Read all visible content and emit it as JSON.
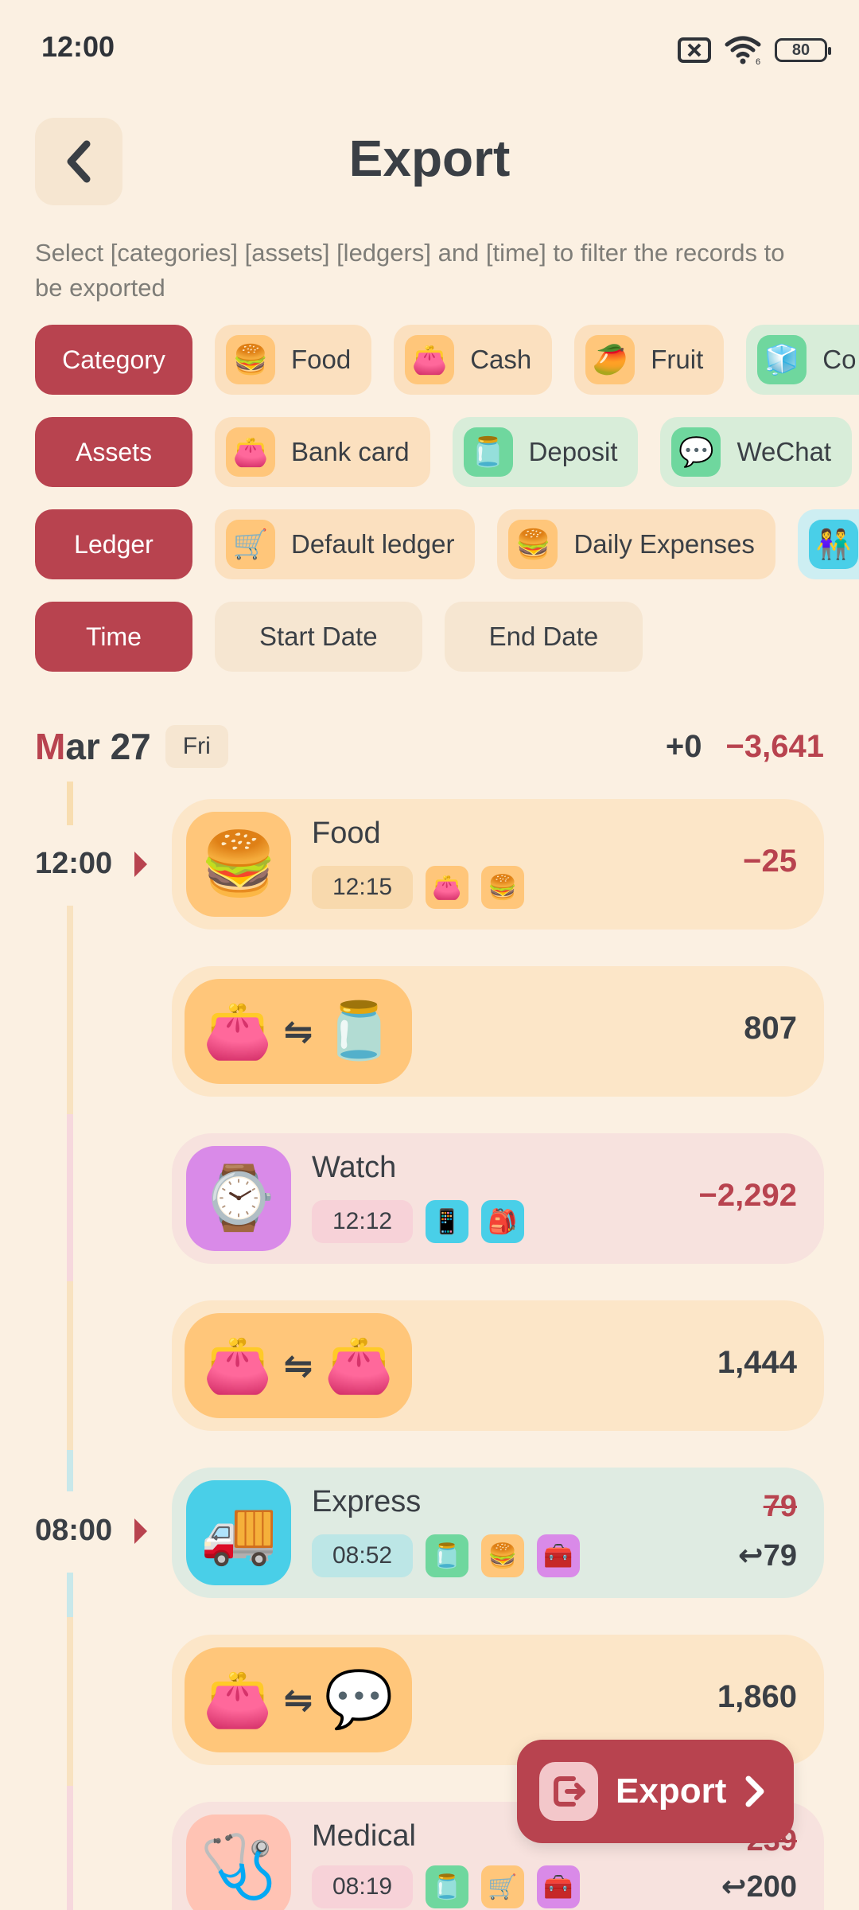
{
  "status": {
    "time": "12:00",
    "battery": "80",
    "wifi_label": "6"
  },
  "header": {
    "title": "Export"
  },
  "hint": "Select [categories] [assets] [ledgers] and [time] to filter the records to be exported",
  "filters": {
    "category": {
      "label": "Category",
      "chips": [
        {
          "label": "Food",
          "icon": "burger-icon",
          "glyph": "🍔"
        },
        {
          "label": "Cash",
          "icon": "wallet-icon",
          "glyph": "👛"
        },
        {
          "label": "Fruit",
          "icon": "mango-icon",
          "glyph": "🥭"
        },
        {
          "label": "Co",
          "icon": "appliance-icon",
          "glyph": "🧊"
        }
      ]
    },
    "assets": {
      "label": "Assets",
      "chips": [
        {
          "label": "Bank card",
          "icon": "wallet-card-icon",
          "glyph": "👛"
        },
        {
          "label": "Deposit",
          "icon": "money-jar-icon",
          "glyph": "🫙"
        },
        {
          "label": "WeChat",
          "icon": "wechat-icon",
          "glyph": "💬"
        }
      ]
    },
    "ledger": {
      "label": "Ledger",
      "chips": [
        {
          "label": "Default ledger",
          "icon": "shopping-cart-icon",
          "glyph": "🛒"
        },
        {
          "label": "Daily Expenses",
          "icon": "burger-icon",
          "glyph": "🍔"
        },
        {
          "label": "",
          "icon": "people-icon",
          "glyph": "👫"
        }
      ]
    },
    "time": {
      "label": "Time",
      "start": "Start Date",
      "end": "End Date"
    }
  },
  "day": {
    "month": "Mar 27",
    "month_first": "M",
    "month_rest": "ar 27",
    "weekday": "Fri",
    "income": "+0",
    "expense": "−3,641"
  },
  "time_labels": [
    "12:00",
    "08:00"
  ],
  "records": [
    {
      "title": "Food",
      "time": "12:15",
      "amount": "−25",
      "icon": "burger-icon",
      "glyph": "🍔",
      "tags": [
        "👛",
        "🍔"
      ]
    },
    {
      "amount": "807",
      "from": "👛",
      "to": "🫙"
    },
    {
      "title": "Watch",
      "time": "12:12",
      "amount": "−2,292",
      "icon": "smartwatch-icon",
      "glyph": "⌚",
      "tags": [
        "📱",
        "🎒"
      ]
    },
    {
      "amount": "1,444",
      "from": "👛",
      "to": "👛"
    },
    {
      "title": "Express",
      "time": "08:52",
      "amount": "79",
      "refund": "79",
      "icon": "delivery-person-icon",
      "glyph": "🚚",
      "tags": [
        "🫙",
        "🍔",
        "🧰"
      ]
    },
    {
      "amount": "1,860",
      "from": "👛",
      "to": "💬"
    },
    {
      "title": "Medical",
      "time": "08:19",
      "amount": "239",
      "refund": "200",
      "icon": "stethoscope-heart-icon",
      "glyph": "🩺",
      "tags": [
        "🫙",
        "🛒",
        "🧰"
      ]
    }
  ],
  "fab": {
    "label": "Export"
  }
}
